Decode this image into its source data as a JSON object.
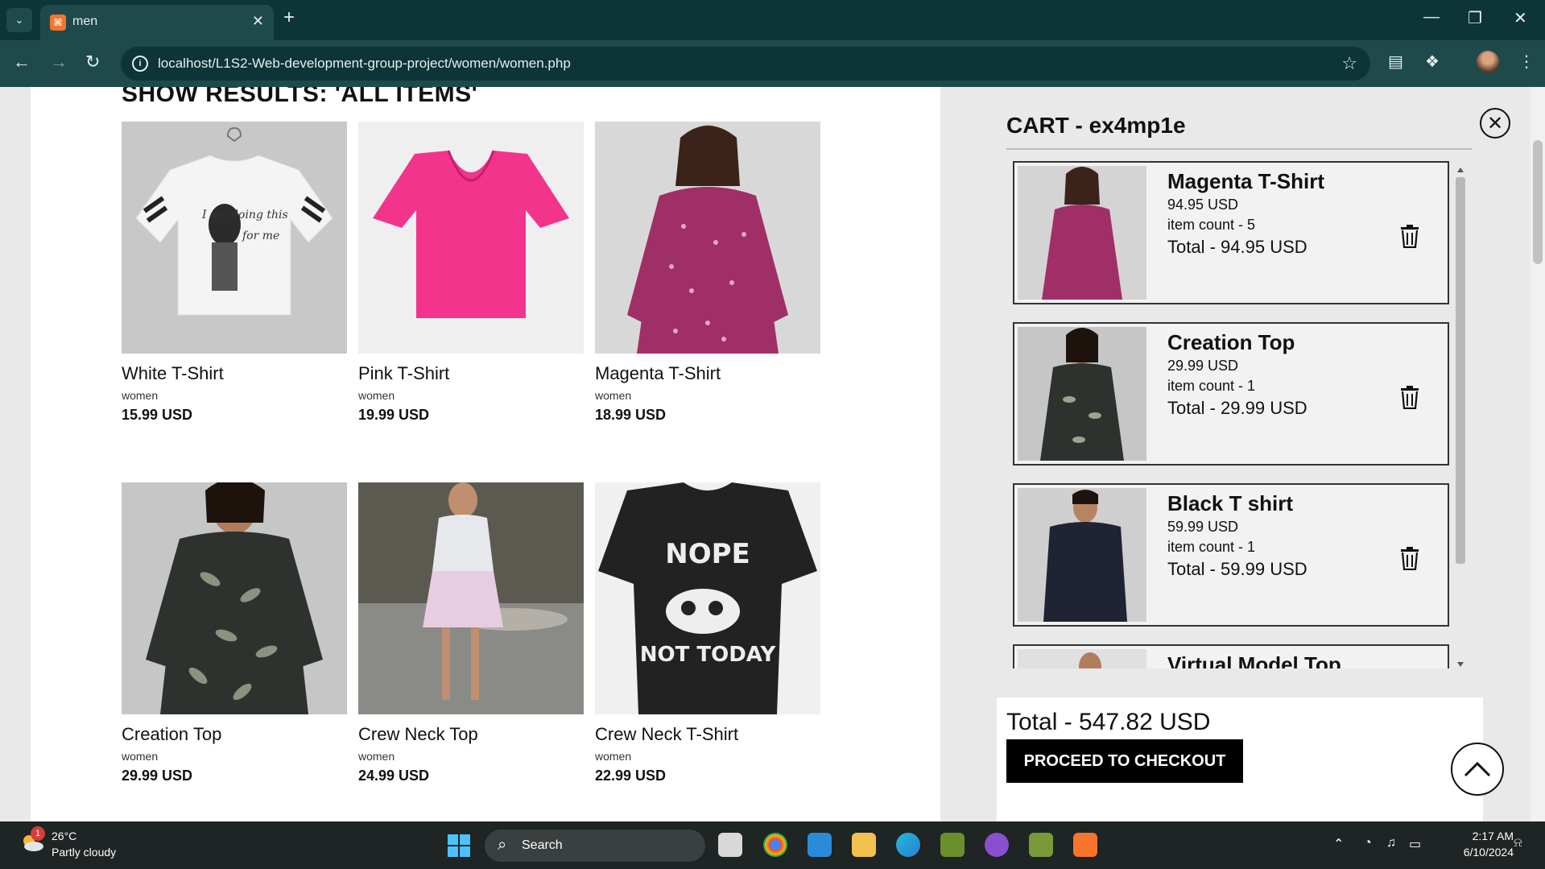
{
  "browser": {
    "tab_title": "men",
    "url": "localhost/L1S2-Web-development-group-project/women/women.php"
  },
  "page": {
    "results_title": "SHOW RESULTS: 'ALL ITEMS'",
    "products": [
      {
        "name": "White T-Shirt",
        "category": "women",
        "price": "15.99 USD"
      },
      {
        "name": "Pink T-Shirt",
        "category": "women",
        "price": "19.99 USD"
      },
      {
        "name": "Magenta T-Shirt",
        "category": "women",
        "price": "18.99 USD"
      },
      {
        "name": "Creation Top",
        "category": "women",
        "price": "29.99 USD"
      },
      {
        "name": "Crew Neck Top",
        "category": "women",
        "price": "24.99 USD"
      },
      {
        "name": "Crew Neck T-Shirt",
        "category": "women",
        "price": "22.99 USD"
      }
    ],
    "shirt_text": {
      "line1": "NOPE",
      "line2": "NOT TODAY",
      "script": "I am doing this for me"
    }
  },
  "cart": {
    "title": "CART - ex4mp1e",
    "items": [
      {
        "name": "Magenta T-Shirt",
        "price": "94.95 USD",
        "count": "item count - 5",
        "total": "Total - 94.95 USD"
      },
      {
        "name": "Creation Top",
        "price": "29.99 USD",
        "count": "item count - 1",
        "total": "Total - 29.99 USD"
      },
      {
        "name": "Black T shirt",
        "price": "59.99 USD",
        "count": "item count - 1",
        "total": "Total - 59.99 USD"
      },
      {
        "name": "Virtual Model Top",
        "price": "",
        "count": "",
        "total": ""
      }
    ],
    "grand_total": "Total - 547.82 USD",
    "checkout_label": "PROCEED TO CHECKOUT"
  },
  "taskbar": {
    "weather_temp": "26°C",
    "weather_desc": "Partly cloudy",
    "weather_badge": "1",
    "search_label": "Search",
    "time": "2:17 AM",
    "date": "6/10/2024"
  },
  "colors": {
    "tabbar": "#0d3436",
    "toolbar": "#1f4a4c",
    "taskbar": "#1f2424",
    "checkout": "#000000"
  }
}
